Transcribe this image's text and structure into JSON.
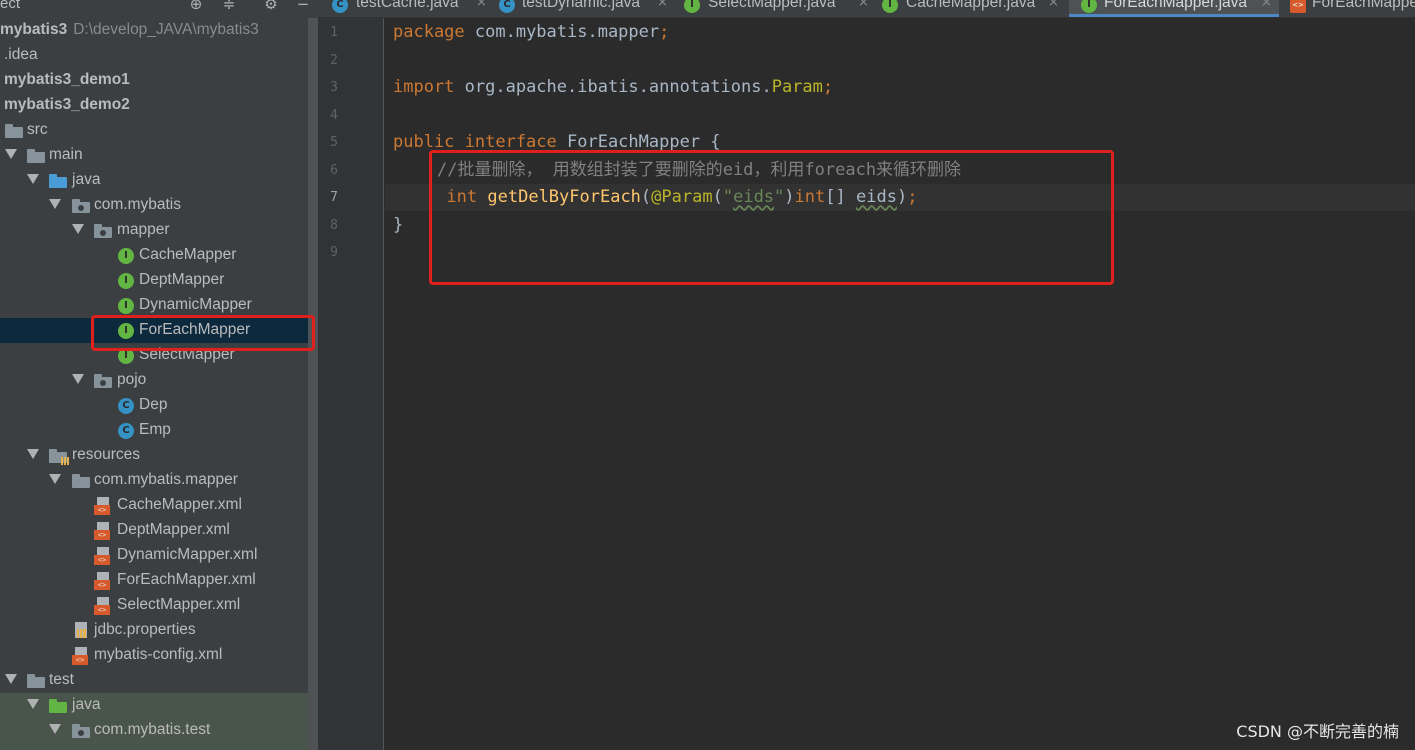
{
  "panel": {
    "title": "ect",
    "icons": [
      "target-icon",
      "collapse-icon",
      "gear-icon",
      "minimize-icon"
    ]
  },
  "tree": {
    "root": {
      "label": "mybatis3",
      "path": "D:\\develop_JAVA\\mybatis3"
    },
    "idea": ".idea",
    "demo1": "mybatis3_demo1",
    "demo2": "mybatis3_demo2",
    "src": "src",
    "main": "main",
    "java": "java",
    "com_mybatis": "com.mybatis",
    "mapper": "mapper",
    "mappers": [
      "CacheMapper",
      "DeptMapper",
      "DynamicMapper",
      "ForEachMapper",
      "SelectMapper"
    ],
    "pojo": "pojo",
    "pojos": [
      "Dep",
      "Emp"
    ],
    "resources": "resources",
    "com_mybatis_mapper": "com.mybatis.mapper",
    "xmls": [
      "CacheMapper.xml",
      "DeptMapper.xml",
      "DynamicMapper.xml",
      "ForEachMapper.xml",
      "SelectMapper.xml"
    ],
    "jdbc": "jdbc.properties",
    "config": "mybatis-config.xml",
    "test": "test",
    "test_java": "java",
    "com_mybatis_test": "com.mybatis.test"
  },
  "tabs": [
    {
      "label": "testCache.java",
      "icon": "C"
    },
    {
      "label": "testDynamic.java",
      "icon": "C"
    },
    {
      "label": "SelectMapper.java",
      "icon": "I"
    },
    {
      "label": "CacheMapper.java",
      "icon": "I"
    },
    {
      "label": "ForEachMapper.java",
      "icon": "I"
    },
    {
      "label": "ForEachMappe",
      "icon": "xml"
    }
  ],
  "code": {
    "line_numbers": [
      "1",
      "2",
      "3",
      "4",
      "5",
      "6",
      "7",
      "8",
      "9"
    ],
    "l1_kw": "package",
    "l1_rest": " com.mybatis.mapper",
    "semi": ";",
    "l3_kw": "import",
    "l3_rest": " org.apache.ibatis.annotations.",
    "l3_ann": "Param",
    "l5_kw": "public interface",
    "l5_rest": " ForEachMapper {",
    "l6_comment": "//批量删除， 用数组封装了要删除的eid，利用foreach来循环删除",
    "l7_type": "int",
    "l7_fn": "getDelByForEach",
    "l7_ann": "@Param",
    "l7_str_open": "\"",
    "l7_str": "eids",
    "l7_str_close": "\"",
    "l7_type2": "int",
    "l7_arr": "[] ",
    "l7_param": "eids",
    "l7_close": ")",
    "l8": "}"
  },
  "watermark": "CSDN @不断完善的楠",
  "colors": {
    "highlight": "#e0211b",
    "accent": "#4a88c7"
  }
}
